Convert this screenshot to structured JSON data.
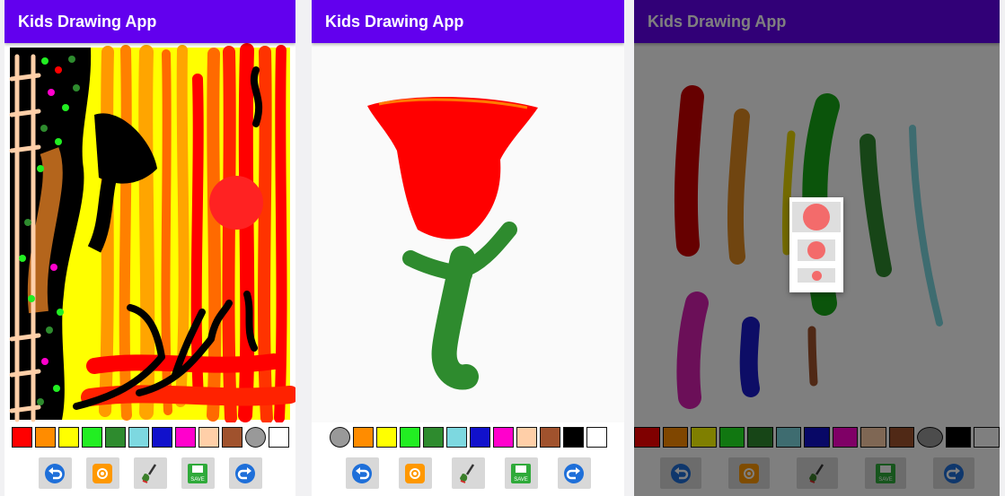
{
  "screens": [
    {
      "id": "forest",
      "title": "Kids Drawing App",
      "palette": [
        "#ff0000",
        "#ff8c00",
        "#ffff00",
        "#22ee22",
        "#2e8b2e",
        "#7dd8e0",
        "#1111cc",
        "#ff00cc",
        "#ffcfa8",
        "#a0522d",
        "#999999",
        "#ffffff"
      ],
      "round_swatches": [
        10
      ]
    },
    {
      "id": "rose",
      "title": "Kids Drawing App",
      "palette": [
        "#999999",
        "#ff8c00",
        "#ffff00",
        "#22ee22",
        "#2e8b2e",
        "#7dd8e0",
        "#1111cc",
        "#ff00cc",
        "#ffcfa8",
        "#a0522d",
        "#000000",
        "#ffffff"
      ],
      "round_swatches": [
        0
      ]
    },
    {
      "id": "strokes",
      "title": "Kids Drawing App",
      "palette": [
        "#ff0000",
        "#ff8c00",
        "#ffff00",
        "#22ee22",
        "#2e8b2e",
        "#7dd8e0",
        "#1111cc",
        "#ff00cc",
        "#ffcfa8",
        "#a0522d",
        "#999999",
        "#000000",
        "#ffffff"
      ],
      "round_swatches": [
        10
      ],
      "brush_dialog": {
        "sizes": [
          "large",
          "medium",
          "small"
        ],
        "color": "#f36b6b"
      }
    }
  ],
  "tools": [
    {
      "name": "undo",
      "icon": "undo-icon"
    },
    {
      "name": "gallery",
      "icon": "gallery-flower-icon"
    },
    {
      "name": "brush",
      "icon": "paint-brush-icon"
    },
    {
      "name": "save",
      "icon": "save-icon",
      "label": "SAVE"
    },
    {
      "name": "redo",
      "icon": "redo-icon"
    }
  ],
  "colors": {
    "appbar": "#6200ee",
    "brush_dot": "#f36b6b"
  }
}
